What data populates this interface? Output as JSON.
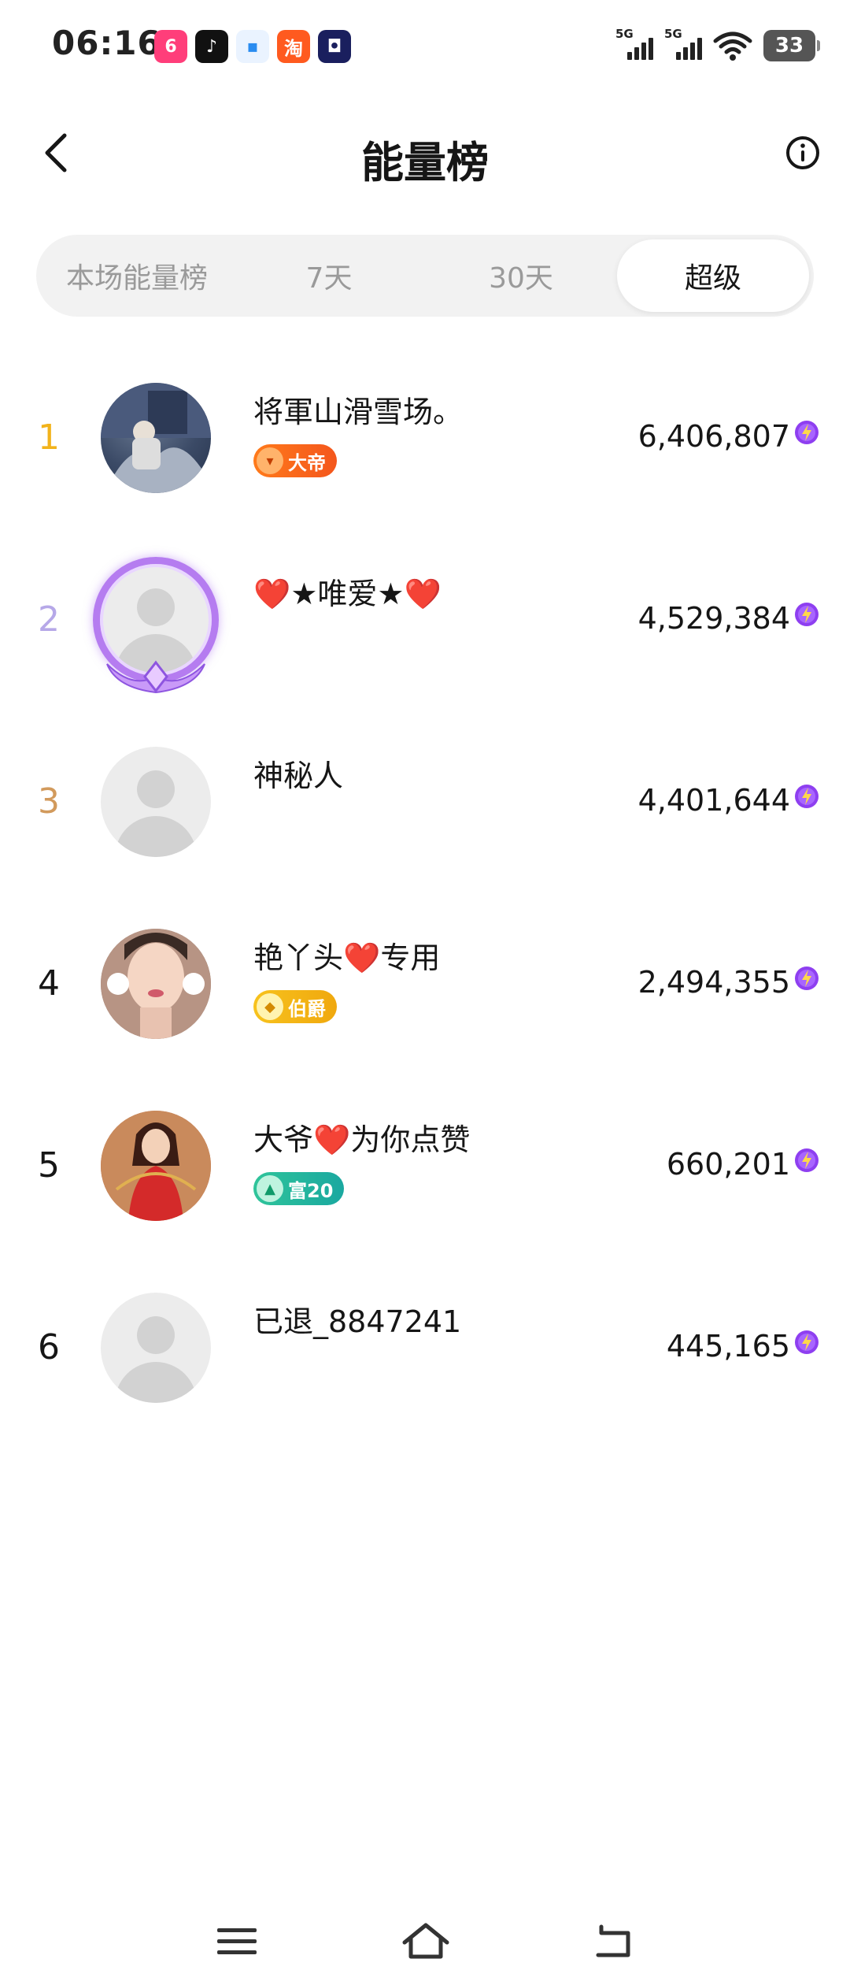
{
  "status_bar": {
    "time": "06:16",
    "app_icons": [
      {
        "name": "video-app-icon",
        "glyph": "6",
        "color": "#ff3e7a"
      },
      {
        "name": "tiktok-icon",
        "glyph": "♪",
        "color": "#111111"
      },
      {
        "name": "cloud-app-icon",
        "glyph": "▪",
        "color": "#2a8cf0"
      },
      {
        "name": "taobao-icon",
        "glyph": "淘",
        "color": "#ff5a1f"
      },
      {
        "name": "chat-app-icon",
        "glyph": "◘",
        "color": "#1a1f5e"
      }
    ],
    "signal_1": "5G",
    "signal_2": "5G",
    "battery": "33"
  },
  "header": {
    "title": "能量榜"
  },
  "tabs": [
    {
      "label": "本场能量榜",
      "active": false
    },
    {
      "label": "7天",
      "active": false
    },
    {
      "label": "30天",
      "active": false
    },
    {
      "label": "超级",
      "active": true
    }
  ],
  "ranking": [
    {
      "rank": "1",
      "rank_color": "#f2b31b",
      "name": "将軍山滑雪场。",
      "badge": "大帝",
      "badge_style": "orange",
      "badge_icon": "▾",
      "score": "6,406,807",
      "avatar": "photo-ski"
    },
    {
      "rank": "2",
      "rank_color": "#b6a8e8",
      "name": "❤️★唯爱★❤️",
      "badge": "",
      "score": "4,529,384",
      "avatar": "placeholder-framed"
    },
    {
      "rank": "3",
      "rank_color": "#d29a5c",
      "name": "神秘人",
      "badge": "",
      "score": "4,401,644",
      "avatar": "placeholder"
    },
    {
      "rank": "4",
      "rank_color": "#161616",
      "name": "艳丫头❤️专用",
      "badge": "伯爵",
      "badge_style": "gold",
      "badge_icon": "◆",
      "score": "2,494,355",
      "avatar": "photo-woman"
    },
    {
      "rank": "5",
      "rank_color": "#161616",
      "name": "大爷❤️为你点赞",
      "badge": "富20",
      "badge_style": "teal",
      "badge_icon": "▲",
      "score": "660,201",
      "avatar": "photo-dancer"
    },
    {
      "rank": "6",
      "rank_color": "#161616",
      "name": "已退_8847241",
      "badge": "",
      "score": "445,165",
      "avatar": "placeholder"
    }
  ],
  "colors": {
    "energy_purple": "#8e3ff0",
    "energy_yellow": "#ffd84a"
  }
}
